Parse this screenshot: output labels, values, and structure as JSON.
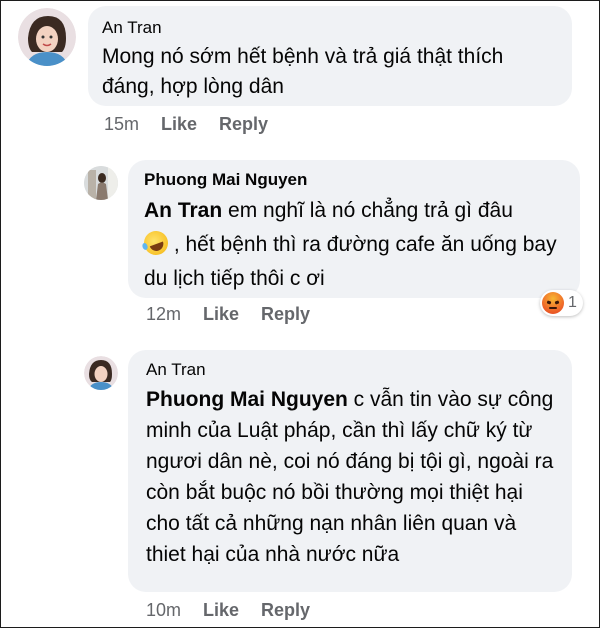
{
  "comments": [
    {
      "author": "An Tran",
      "text": "Mong nó sớm hết bệnh và trả giá thật thích đáng, hợp lòng dân",
      "time": "15m",
      "like_label": "Like",
      "reply_label": "Reply"
    },
    {
      "author": "Phuong Mai Nguyen",
      "mention": "An Tran",
      "text_before_emoji": " em nghĩ là nó chẳng trả gì đâu",
      "emoji": "rolling-on-floor-laughing",
      "text_after_emoji": " , hết bệnh thì ra đường cafe ăn uống bay du lịch tiếp thôi c ơi",
      "time": "12m",
      "like_label": "Like",
      "reply_label": "Reply",
      "reaction": {
        "type": "angry",
        "count": "1"
      }
    },
    {
      "author": "An Tran",
      "mention": "Phuong Mai Nguyen",
      "text": " c vẫn tin vào sự công minh của Luật pháp, cần thì lấy chữ ký từ ngươi dân nè, coi nó đáng bị tội gì, ngoài ra còn bắt buộc nó bồi thường mọi thiệt hại cho tất cả những nạn nhân liên quan và thiet hại của nhà nước nữa",
      "time": "10m",
      "like_label": "Like",
      "reply_label": "Reply"
    }
  ],
  "colors": {
    "bubble_bg": "#f0f2f5",
    "meta_text": "#65676b",
    "text": "#050505"
  }
}
